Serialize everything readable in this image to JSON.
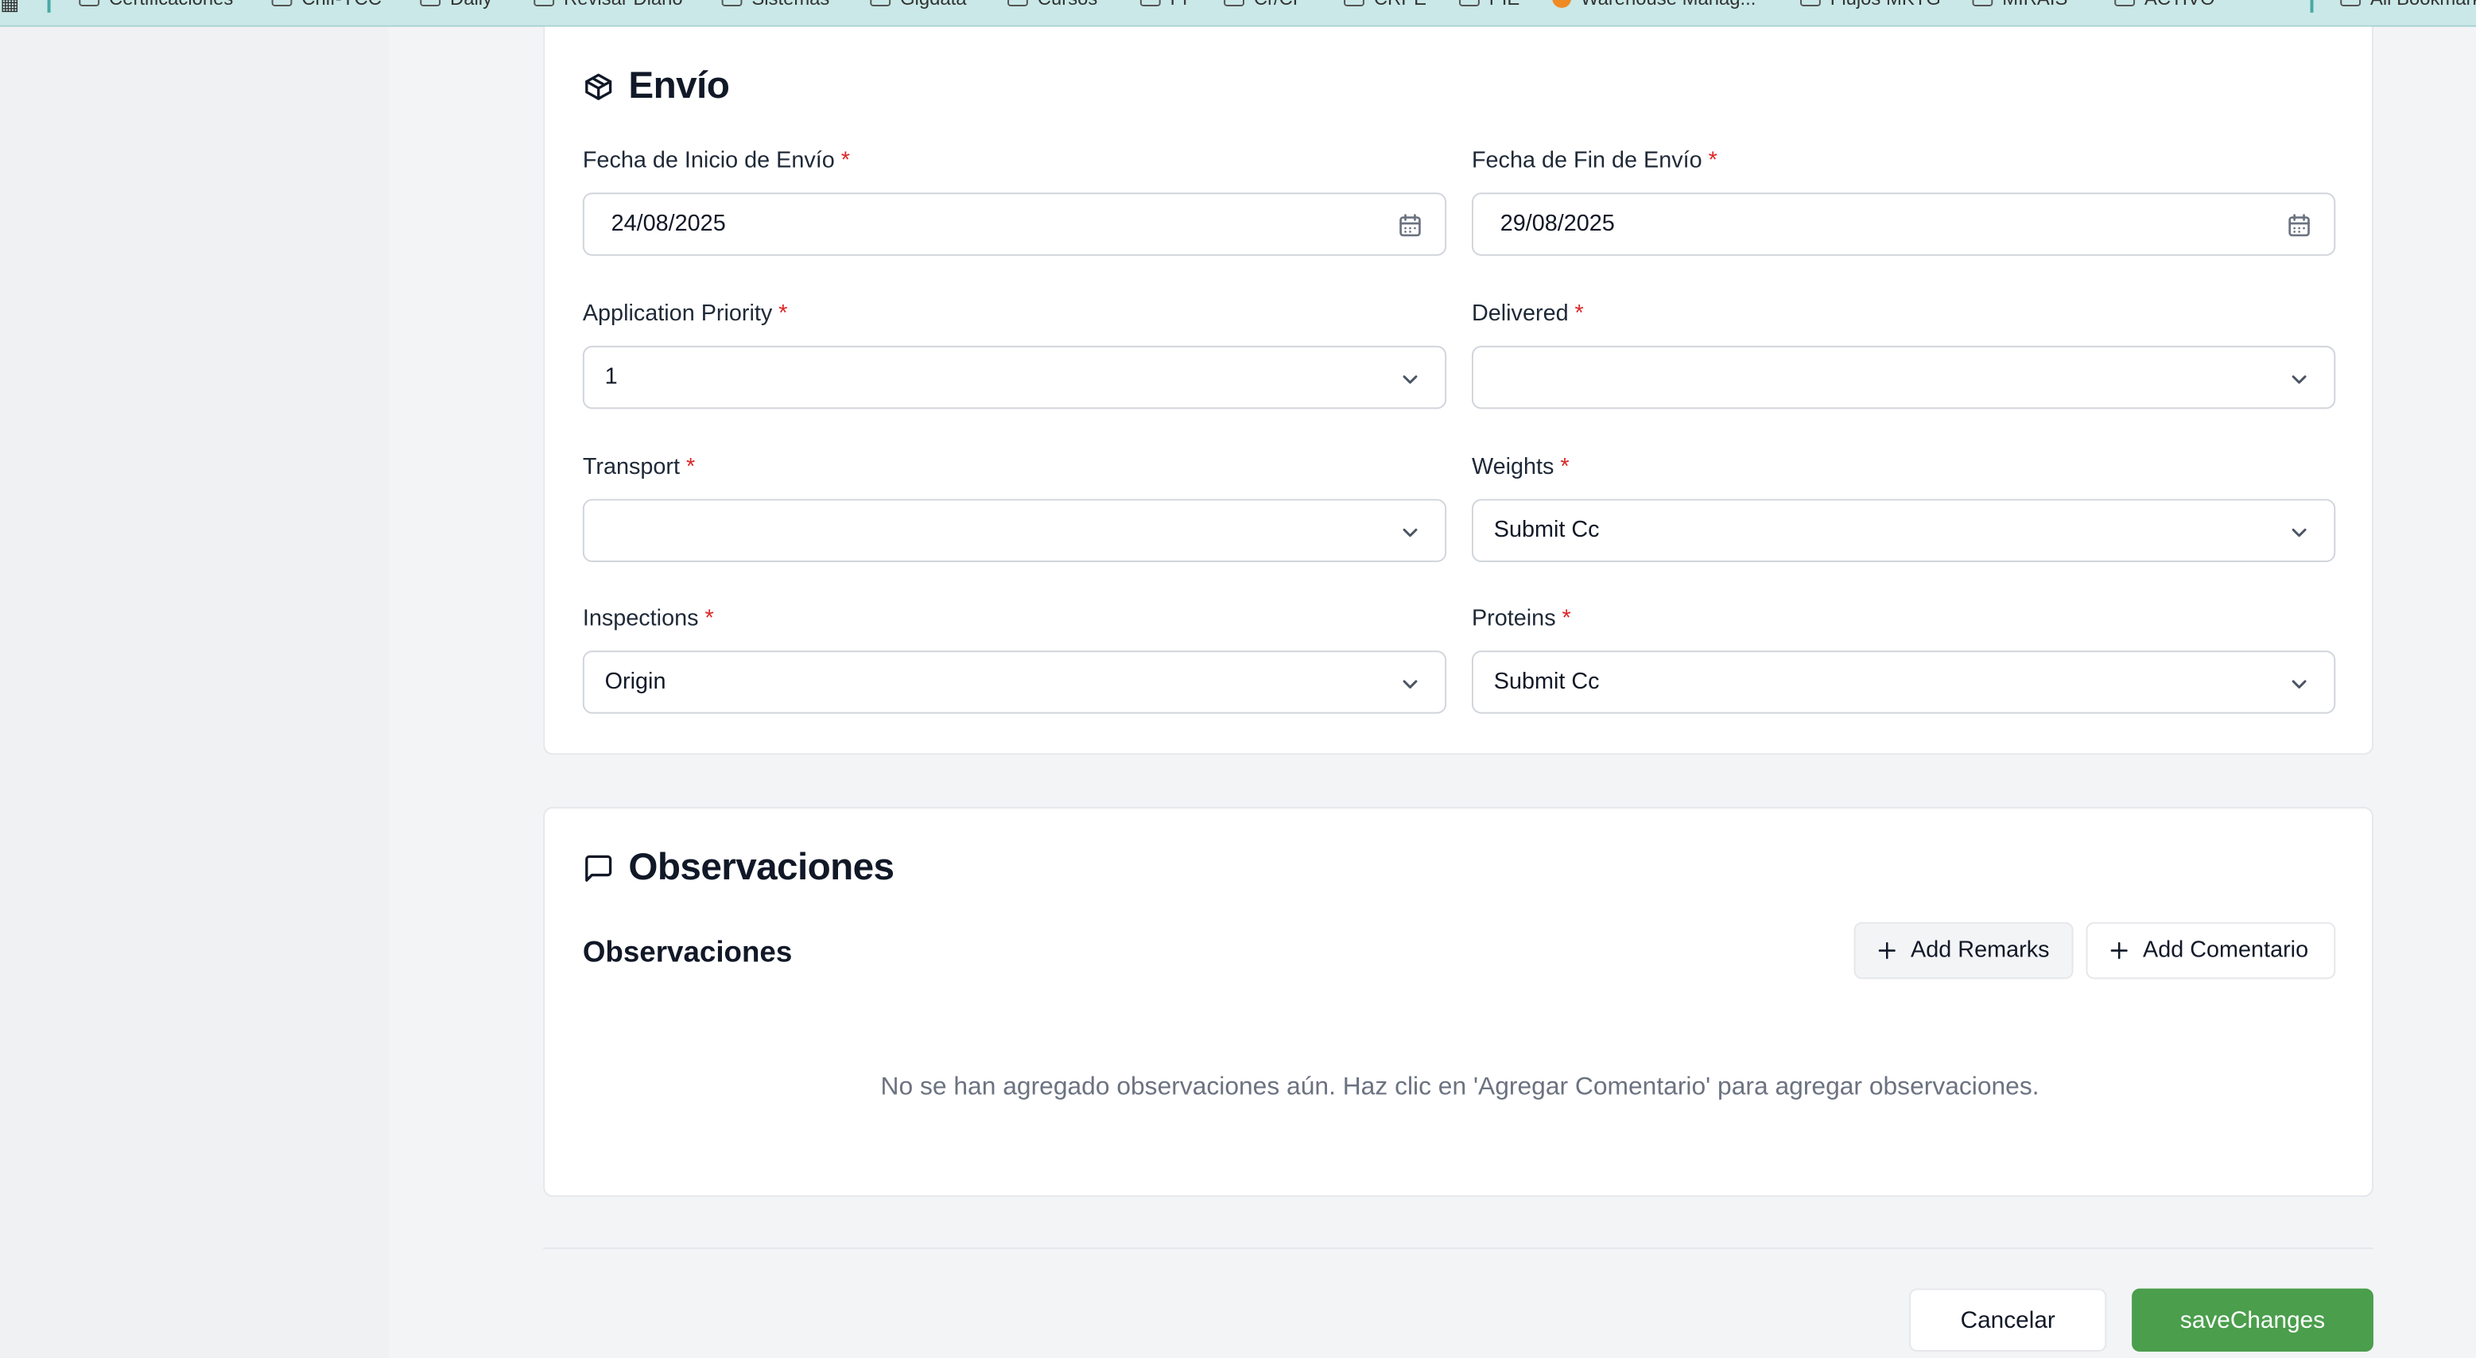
{
  "bookmarks": [
    "Certificaciones",
    "Chif-YCC",
    "Daily",
    "Revisar Diario",
    "Sistemas",
    "Gigdata",
    "Cursos",
    "Pr",
    "Cr/CP",
    "CRPE",
    "PIE",
    "Warehouse Manag...",
    "Flujos MKTG",
    "MIRAIS",
    "ACTIVO",
    "All Bookmarks"
  ],
  "shipping": {
    "title": "Envío",
    "fields": {
      "start_date": {
        "label": "Fecha de Inicio de Envío",
        "value": "24/08/2025"
      },
      "end_date": {
        "label": "Fecha de Fin de Envío",
        "value": "29/08/2025"
      },
      "application_priority": {
        "label": "Application Priority",
        "value": "1"
      },
      "delivered": {
        "label": "Delivered",
        "value": ""
      },
      "transport": {
        "label": "Transport",
        "value": ""
      },
      "weights": {
        "label": "Weights",
        "value": "Submit Cc"
      },
      "inspections": {
        "label": "Inspections",
        "value": "Origin"
      },
      "proteins": {
        "label": "Proteins",
        "value": "Submit Cc"
      }
    },
    "required_mark": "*"
  },
  "observations": {
    "title": "Observaciones",
    "subtitle": "Observaciones",
    "add_remarks_label": "Add Remarks",
    "add_comment_label": "Add Comentario",
    "empty_message": "No se han agregado observaciones aún. Haz clic en 'Agregar Comentario' para agregar observaciones."
  },
  "footer": {
    "cancel_label": "Cancelar",
    "save_label": "saveChanges"
  },
  "colors": {
    "save_button": "#4a9e4c",
    "required": "#dc2626",
    "bookmarks_bar": "#c9e8e7"
  },
  "icons": {
    "shipping": "package-icon",
    "observations": "message-square-icon",
    "date": "calendar-icon",
    "select": "chevron-down-icon",
    "add": "plus-icon"
  }
}
